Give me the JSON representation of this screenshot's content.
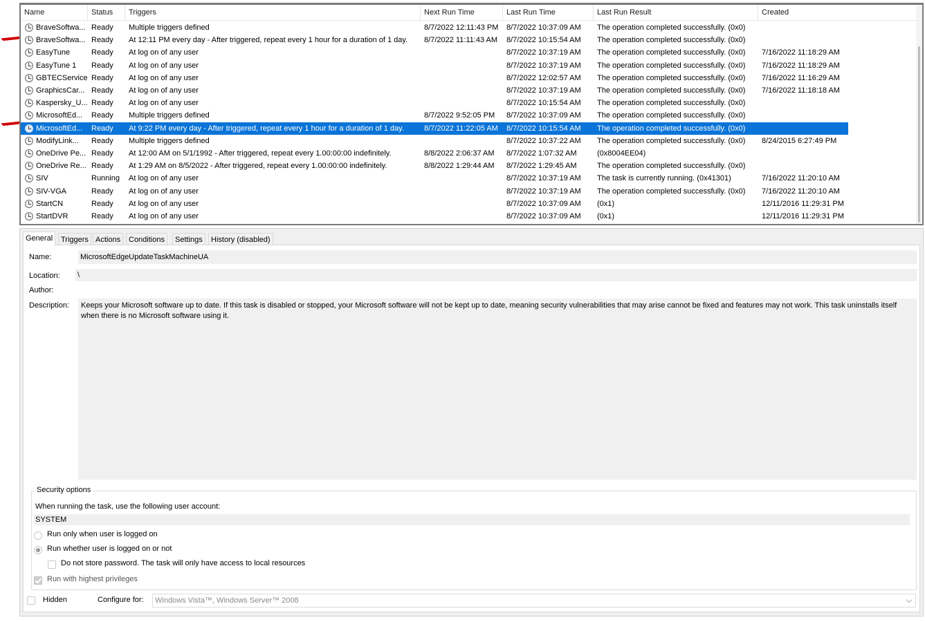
{
  "columns": {
    "name": "Name",
    "status": "Status",
    "triggers": "Triggers",
    "next_run": "Next Run Time",
    "last_run": "Last Run Time",
    "last_result": "Last Run Result",
    "created": "Created"
  },
  "tasks": [
    {
      "name": "BraveSoftwa...",
      "status": "Ready",
      "triggers": "Multiple triggers defined",
      "next_run": "8/7/2022 12:11:43 PM",
      "last_run": "8/7/2022 10:37:09 AM",
      "last_result": "The operation completed successfully. (0x0)",
      "created": ""
    },
    {
      "name": "BraveSoftwa...",
      "status": "Ready",
      "triggers": "At 12:11 PM every day - After triggered, repeat every 1 hour for a duration of 1 day.",
      "next_run": "8/7/2022 11:11:43 AM",
      "last_run": "8/7/2022 10:15:54 AM",
      "last_result": "The operation completed successfully. (0x0)",
      "created": ""
    },
    {
      "name": "EasyTune",
      "status": "Ready",
      "triggers": "At log on of any user",
      "next_run": "",
      "last_run": "8/7/2022 10:37:19 AM",
      "last_result": "The operation completed successfully. (0x0)",
      "created": "7/16/2022 11:18:29 AM"
    },
    {
      "name": "EasyTune 1",
      "status": "Ready",
      "triggers": "At log on of any user",
      "next_run": "",
      "last_run": "8/7/2022 10:37:19 AM",
      "last_result": "The operation completed successfully. (0x0)",
      "created": "7/16/2022 11:18:29 AM"
    },
    {
      "name": "GBTECService",
      "status": "Ready",
      "triggers": "At log on of any user",
      "next_run": "",
      "last_run": "8/7/2022 12:02:57 AM",
      "last_result": "The operation completed successfully. (0x0)",
      "created": "7/16/2022 11:16:29 AM"
    },
    {
      "name": "GraphicsCar...",
      "status": "Ready",
      "triggers": "At log on of any user",
      "next_run": "",
      "last_run": "8/7/2022 10:37:19 AM",
      "last_result": "The operation completed successfully. (0x0)",
      "created": "7/16/2022 11:18:18 AM"
    },
    {
      "name": "Kaspersky_U...",
      "status": "Ready",
      "triggers": "At log on of any user",
      "next_run": "",
      "last_run": "8/7/2022 10:15:54 AM",
      "last_result": "The operation completed successfully. (0x0)",
      "created": ""
    },
    {
      "name": "MicrosoftEd...",
      "status": "Ready",
      "triggers": "Multiple triggers defined",
      "next_run": "8/7/2022 9:52:05 PM",
      "last_run": "8/7/2022 10:37:09 AM",
      "last_result": "The operation completed successfully. (0x0)",
      "created": ""
    },
    {
      "name": "MicrosoftEd...",
      "status": "Ready",
      "triggers": "At 9:22 PM every day - After triggered, repeat every 1 hour for a duration of 1 day.",
      "next_run": "8/7/2022 11:22:05 AM",
      "last_run": "8/7/2022 10:15:54 AM",
      "last_result": "The operation completed successfully. (0x0)",
      "created": "",
      "selected": true
    },
    {
      "name": "ModifyLink...",
      "status": "Ready",
      "triggers": "Multiple triggers defined",
      "next_run": "",
      "last_run": "8/7/2022 10:37:22 AM",
      "last_result": "The operation completed successfully. (0x0)",
      "created": "8/24/2015 6:27:49 PM"
    },
    {
      "name": "OneDrive Pe...",
      "status": "Ready",
      "triggers": "At 12:00 AM on 5/1/1992 - After triggered, repeat every 1.00:00:00 indefinitely.",
      "next_run": "8/8/2022 2:06:37 AM",
      "last_run": "8/7/2022 1:07:32 AM",
      "last_result": "(0x8004EE04)",
      "created": ""
    },
    {
      "name": "OneDrive Re...",
      "status": "Ready",
      "triggers": "At 1:29 AM on 8/5/2022 - After triggered, repeat every 1.00:00:00 indefinitely.",
      "next_run": "8/8/2022 1:29:44 AM",
      "last_run": "8/7/2022 1:29:45 AM",
      "last_result": "The operation completed successfully. (0x0)",
      "created": ""
    },
    {
      "name": "SIV",
      "status": "Running",
      "triggers": "At log on of any user",
      "next_run": "",
      "last_run": "8/7/2022 10:37:19 AM",
      "last_result": "The task is currently running. (0x41301)",
      "created": "7/16/2022 11:20:10 AM"
    },
    {
      "name": "SIV-VGA",
      "status": "Ready",
      "triggers": "At log on of any user",
      "next_run": "",
      "last_run": "8/7/2022 10:37:19 AM",
      "last_result": "The operation completed successfully. (0x0)",
      "created": "7/16/2022 11:20:10 AM"
    },
    {
      "name": "StartCN",
      "status": "Ready",
      "triggers": "At log on of any user",
      "next_run": "",
      "last_run": "8/7/2022 10:37:09 AM",
      "last_result": "(0x1)",
      "created": "12/11/2016 11:29:31 PM"
    },
    {
      "name": "StartDVR",
      "status": "Ready",
      "triggers": "At log on of any user",
      "next_run": "",
      "last_run": "8/7/2022 10:37:09 AM",
      "last_result": "(0x1)",
      "created": "12/11/2016 11:29:31 PM"
    }
  ],
  "tabs": [
    "General",
    "Triggers",
    "Actions",
    "Conditions",
    "Settings",
    "History (disabled)"
  ],
  "general": {
    "name_label": "Name:",
    "name_value": "MicrosoftEdgeUpdateTaskMachineUA",
    "location_label": "Location:",
    "location_value": "\\",
    "author_label": "Author:",
    "author_value": "",
    "description_label": "Description:",
    "description_value": "Keeps your Microsoft software up to date. If this task is disabled or stopped, your Microsoft software will not be kept up to date, meaning security vulnerabilities that may arise cannot be fixed and features may not work. This task uninstalls itself when there is no Microsoft software using it."
  },
  "security": {
    "legend": "Security options",
    "account_prompt": "When running the task, use the following user account:",
    "account_value": "SYSTEM",
    "option_logged_on": "Run only when user is logged on",
    "option_whether": "Run whether user is logged on or not",
    "option_no_password": "Do not store password.  The task will only have access to local resources",
    "option_highest": "Run with highest privileges",
    "selected_option": "Run whether user is logged on or not",
    "highest_checked": true,
    "no_password_checked": false
  },
  "footer": {
    "hidden_label": "Hidden",
    "hidden_checked": false,
    "configure_label": "Configure for:",
    "configure_value": "Windows Vista™, Windows Server™ 2008"
  },
  "colors": {
    "selection": "#0a74d8",
    "annotation": "#d00000"
  }
}
